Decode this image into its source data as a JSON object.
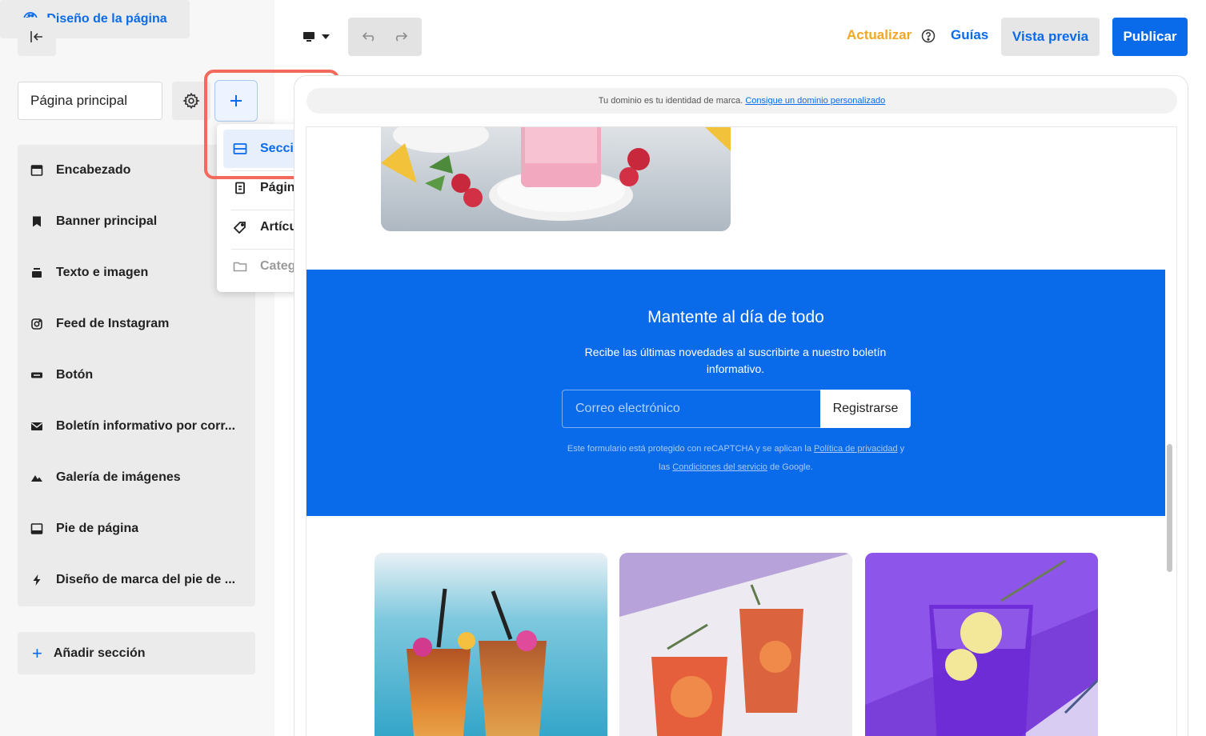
{
  "sidebar": {
    "design_button": "Diseño de la página",
    "page_select": "Página principal",
    "sections": [
      {
        "label": "Encabezado",
        "icon": "header-icon"
      },
      {
        "label": "Banner principal",
        "icon": "bookmark-icon"
      },
      {
        "label": "Texto e imagen",
        "icon": "text-image-icon"
      },
      {
        "label": "Feed de Instagram",
        "icon": "instagram-icon"
      },
      {
        "label": "Botón",
        "icon": "button-icon"
      },
      {
        "label": "Boletín informativo por corr...",
        "icon": "envelope-icon"
      },
      {
        "label": "Galería de imágenes",
        "icon": "gallery-icon"
      },
      {
        "label": "Pie de página",
        "icon": "footer-icon"
      },
      {
        "label": "Diseño de marca del pie de ...",
        "icon": "bolt-icon"
      }
    ],
    "add_section": "Añadir sección"
  },
  "dropdown": {
    "items": [
      {
        "label": "Sección",
        "icon": "section-icon",
        "state": "active"
      },
      {
        "label": "Página",
        "icon": "page-icon",
        "state": "normal"
      },
      {
        "label": "Artículo",
        "icon": "tag-icon",
        "state": "normal"
      },
      {
        "label": "Categoría",
        "icon": "folder-icon",
        "state": "disabled"
      }
    ]
  },
  "toolbar": {
    "update": "Actualizar",
    "guides": "Guías",
    "preview": "Vista previa",
    "publish": "Publicar"
  },
  "canvas": {
    "domain_text": "Tu dominio es tu identidad de marca.",
    "domain_link": "Consigue un dominio personalizado",
    "newsletter": {
      "title": "Mantente al día de todo",
      "subtitle": "Recibe las últimas novedades al suscribirte a nuestro boletín informativo.",
      "email_placeholder": "Correo electrónico",
      "submit": "Registrarse",
      "legal_1": "Este formulario está protegido con reCAPTCHA y se aplican la",
      "legal_link_1": "Política de privacidad",
      "legal_2": "y las",
      "legal_link_2": "Condiciones del servicio",
      "legal_3": "de Google."
    }
  },
  "colors": {
    "accent": "#0a6bea",
    "update": "#f5a623",
    "highlight": "#f26a5c"
  }
}
